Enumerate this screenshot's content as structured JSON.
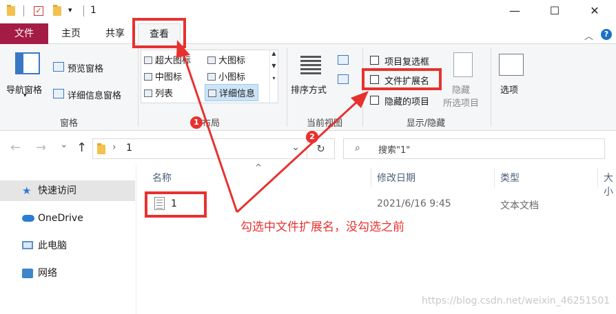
{
  "window": {
    "title": "1",
    "minimize": "—",
    "maximize": "☐",
    "close": "✕",
    "qa_dropdown": "▾"
  },
  "ribbon_tabs": {
    "file": "文件",
    "home": "主页",
    "share": "共享",
    "view": "查看",
    "collapse": "︿",
    "help": "?"
  },
  "panes_group": {
    "nav_pane": "导航窗格",
    "preview_pane": "预览窗格",
    "details_pane": "详细信息窗格",
    "label": "窗格"
  },
  "layout_group": {
    "items": [
      "超大图标",
      "大图标",
      "中图标",
      "小图标",
      "列表",
      "详细信息"
    ],
    "label": "布局"
  },
  "current_view_group": {
    "sort_by": "排序方式",
    "label": "当前视图"
  },
  "show_hide_group": {
    "item_checkboxes": "项目复选框",
    "file_extensions": "文件扩展名",
    "hidden_items": "隐藏的项目",
    "hide_selected_1": "隐藏",
    "hide_selected_2": "所选项目",
    "label": "显示/隐藏"
  },
  "options": {
    "label": "选项"
  },
  "address": {
    "back": "←",
    "forward": "→",
    "recent": "⌄",
    "up": "↑",
    "path_sep": "›",
    "path": "1",
    "dropdown": "⌄",
    "refresh": "↻",
    "search_placeholder": "搜索\"1\""
  },
  "nav_pane": {
    "items": [
      "快速访问",
      "OneDrive",
      "此电脑",
      "网络"
    ]
  },
  "file_list": {
    "columns": [
      "名称",
      "修改日期",
      "类型",
      "大小"
    ],
    "sort_arrow": "^",
    "rows": [
      {
        "name": "1",
        "modified": "2021/6/16 9:45",
        "type": "文本文档"
      }
    ]
  },
  "annotations": {
    "badge_1": "1",
    "badge_2": "2",
    "note": "勾选中文件扩展名，没勾选之前",
    "color": "#e8312f"
  },
  "watermark": "https://blog.csdn.net/weixin_46251501"
}
